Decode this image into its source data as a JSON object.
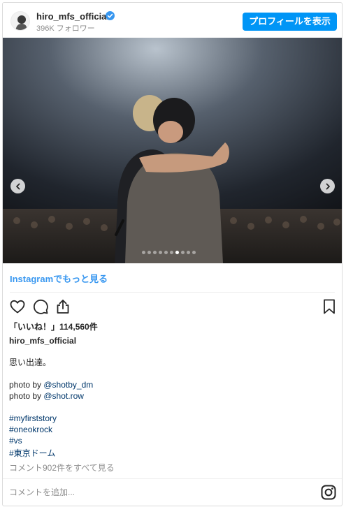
{
  "header": {
    "username": "hiro_mfs_official",
    "followers": "396K フォロワー",
    "profile_button": "プロフィールを表示"
  },
  "photo": {
    "carousel_total": 10,
    "carousel_active": 7
  },
  "more_link": "Instagramでもっと見る",
  "likes": "「いいね！」114,560件",
  "caption": {
    "username": "hiro_mfs_official",
    "text": "思い出達。",
    "credit1_prefix": "photo by ",
    "credit1_handle": "@shotby_dm",
    "credit2_prefix": "photo by ",
    "credit2_handle": "@shot.row",
    "hashtags": [
      "#myfirststory",
      "#oneokrock",
      "#vs",
      "#東京ドーム"
    ]
  },
  "view_comments": "コメント902件をすべて見る",
  "comment": {
    "placeholder": "コメントを追加..."
  },
  "colors": {
    "accent": "#0095f6",
    "link": "#3897f0",
    "hashtag": "#00376b",
    "muted": "#8e8e8e"
  },
  "icons": {
    "verified": "verified-badge-icon",
    "heart": "heart-icon",
    "comment": "comment-icon",
    "share": "share-icon",
    "bookmark": "bookmark-icon",
    "instagram": "instagram-icon",
    "prev": "chevron-left-icon",
    "next": "chevron-right-icon"
  }
}
